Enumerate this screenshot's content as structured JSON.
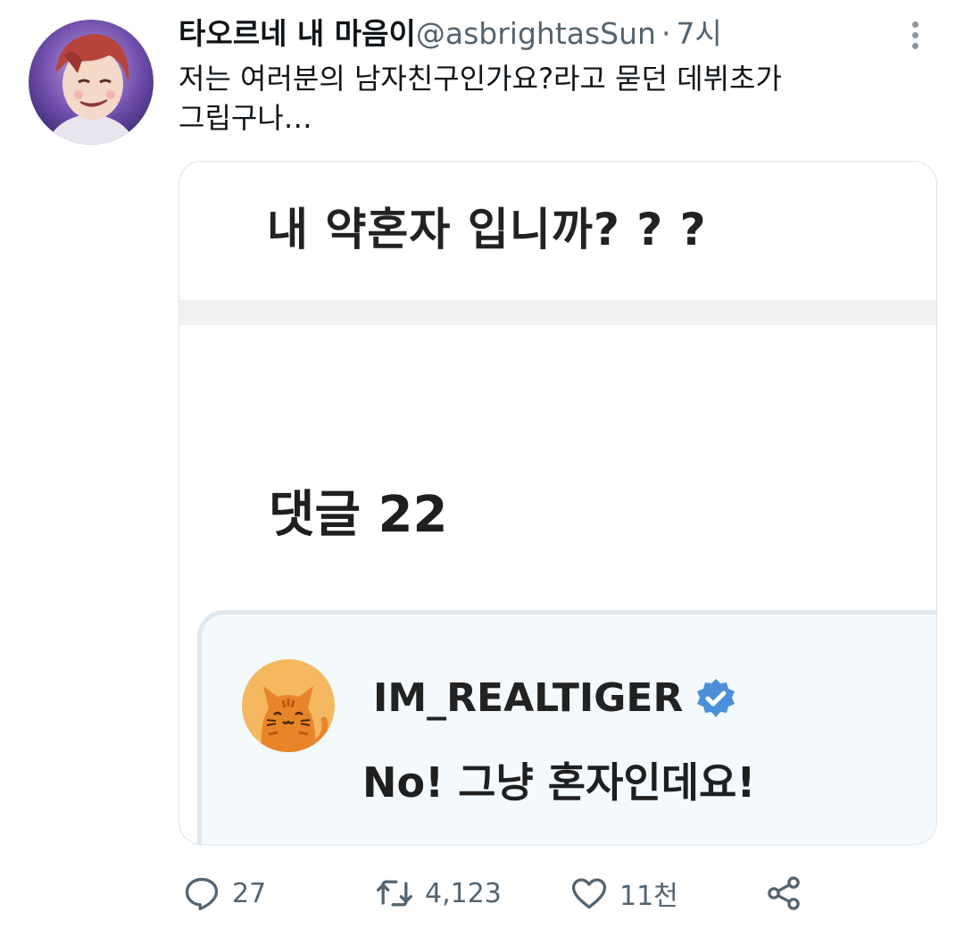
{
  "tweet": {
    "author_name": "타오르네 내 마음이",
    "author_handle": "@asbrightasSun",
    "separator": "·",
    "time": "7시",
    "text_line1": "저는 여러분의 남자친구인가요?라고 묻던 데뷔초가",
    "text_line2": "그립구나…"
  },
  "media": {
    "question": "내 약혼자 입니까? ? ?",
    "comments_label": "댓글 22",
    "comment": {
      "username": "IM_REALTIGER",
      "text": "No! 그냥 혼자인데요!"
    }
  },
  "actions": {
    "replies": "27",
    "retweets": "4,123",
    "likes": "11천"
  },
  "icons": {
    "reply": "reply-icon",
    "retweet": "retweet-icon",
    "like": "heart-icon",
    "share": "share-icon",
    "more": "more-vertical-icon",
    "verified": "verified-badge-icon"
  },
  "colors": {
    "muted": "#536471",
    "verified": "#4a90d9",
    "card_bg": "#f3f9fd"
  }
}
